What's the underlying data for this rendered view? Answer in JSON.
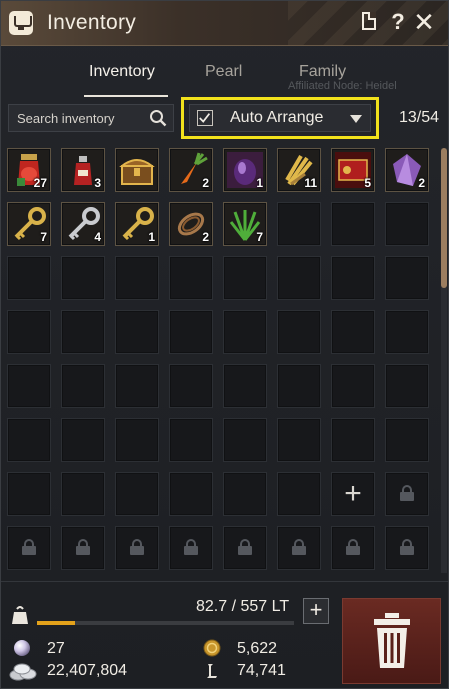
{
  "window": {
    "title": "Inventory"
  },
  "tabs": [
    {
      "label": "Inventory",
      "active": true
    },
    {
      "label": "Pearl",
      "active": false
    },
    {
      "label": "Family",
      "active": false
    }
  ],
  "toolbar": {
    "search_placeholder": "Search inventory",
    "auto_arrange_label": "Auto Arrange",
    "auto_arrange_checked": true,
    "slot_count": "13/54"
  },
  "background_text": {
    "node": "Affiliated Node: Heidel"
  },
  "items": [
    {
      "name": "red-potion-bundle",
      "qty": "27"
    },
    {
      "name": "red-potion",
      "qty": "3"
    },
    {
      "name": "treasure-chest",
      "qty": ""
    },
    {
      "name": "carrot",
      "qty": "2"
    },
    {
      "name": "dark-stone",
      "qty": "1"
    },
    {
      "name": "wheat-bundle",
      "qty": "11"
    },
    {
      "name": "red-ticket",
      "qty": "5"
    },
    {
      "name": "purple-crystal",
      "qty": "2"
    },
    {
      "name": "gold-key",
      "qty": "7"
    },
    {
      "name": "silver-key",
      "qty": "4"
    },
    {
      "name": "gold-key",
      "qty": "1"
    },
    {
      "name": "rope",
      "qty": "2"
    },
    {
      "name": "herb",
      "qty": "7"
    }
  ],
  "footer": {
    "weight_text": "82.7 / 557 LT",
    "weight_ratio": 0.148,
    "pearls": "27",
    "silver": "22,407,804",
    "contribution": "5,622",
    "loyalty": "74,741"
  },
  "colors": {
    "highlight": "#f2e21c",
    "weight_bar": "#e3a21b",
    "trash": "#5a2019"
  }
}
